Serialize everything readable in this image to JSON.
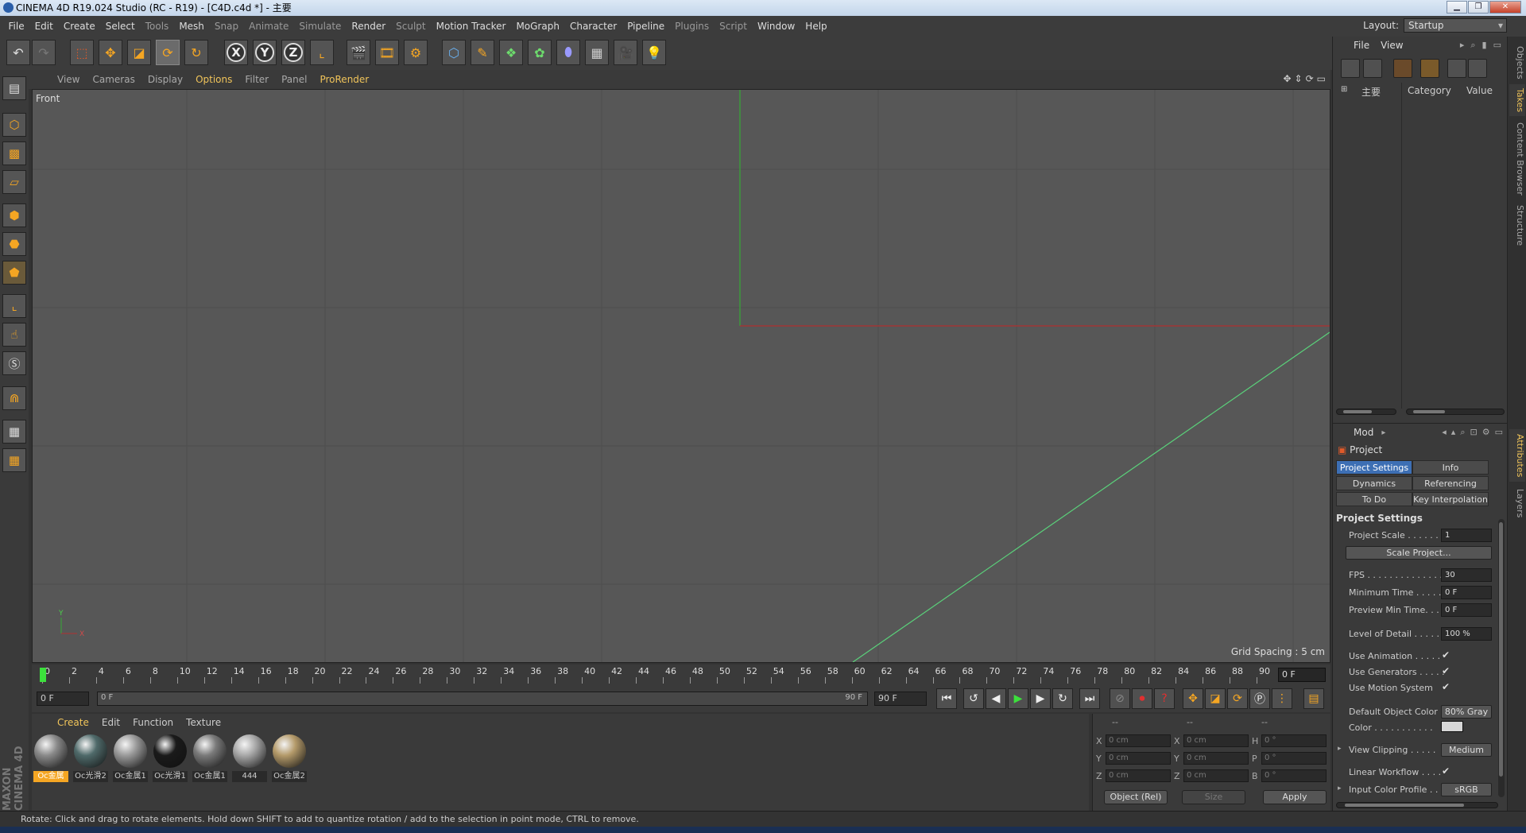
{
  "window": {
    "title": "CINEMA 4D R19.024 Studio (RC - R19) - [C4D.c4d *] - 主要",
    "btn_min": "▁",
    "btn_max": "❐",
    "btn_close": "✕"
  },
  "menu": [
    "File",
    "Edit",
    "Create",
    "Select",
    "Tools",
    "Mesh",
    "Snap",
    "Animate",
    "Simulate",
    "Render",
    "Sculpt",
    "Motion Tracker",
    "MoGraph",
    "Character",
    "Pipeline",
    "Plugins",
    "Script",
    "Window",
    "Help"
  ],
  "layout": {
    "label": "Layout:",
    "value": "Startup"
  },
  "toolbar": {
    "axis_x": "X",
    "axis_y": "Y",
    "axis_z": "Z"
  },
  "viewport_menu": [
    "View",
    "Cameras",
    "Display",
    "Options",
    "Filter",
    "Panel",
    "ProRender"
  ],
  "viewport": {
    "label": "Front",
    "grid_spacing": "Grid Spacing : 5 cm",
    "axis_y": "Y",
    "axis_x": "X"
  },
  "timeline": {
    "ticks": [
      "0",
      "2",
      "4",
      "6",
      "8",
      "10",
      "12",
      "14",
      "16",
      "18",
      "20",
      "22",
      "24",
      "26",
      "28",
      "30",
      "32",
      "34",
      "36",
      "38",
      "40",
      "42",
      "44",
      "46",
      "48",
      "50",
      "52",
      "54",
      "56",
      "58",
      "60",
      "62",
      "64",
      "66",
      "68",
      "70",
      "72",
      "74",
      "76",
      "78",
      "80",
      "82",
      "84",
      "86",
      "88",
      "90"
    ],
    "current_frame": "0 F"
  },
  "transport": {
    "start": "0 F",
    "slider_left": "0 F",
    "slider_right": "90 F",
    "end": "90 F"
  },
  "materials_menu": [
    "Create",
    "Edit",
    "Function",
    "Texture"
  ],
  "materials": [
    {
      "name": "Oc金属",
      "color": "#8a8a8a"
    },
    {
      "name": "Oc光滑2",
      "color": "#4f6a6a"
    },
    {
      "name": "Oc金属1",
      "color": "#9a9a9a"
    },
    {
      "name": "Oc光滑1",
      "color": "#1a1a1a"
    },
    {
      "name": "Oc金属1",
      "color": "#7a7a7a"
    },
    {
      "name": "444",
      "color": "#a8a8a8"
    },
    {
      "name": "Oc金属2",
      "color": "#b49a6a"
    }
  ],
  "coords": {
    "dashes": [
      "--",
      "--",
      "--"
    ],
    "labels": [
      "X",
      "Y",
      "Z",
      "X",
      "Y",
      "Z",
      "H",
      "P",
      "B"
    ],
    "pos": [
      "0 cm",
      "0 cm",
      "0 cm"
    ],
    "size": [
      "0 cm",
      "0 cm",
      "0 cm"
    ],
    "rot": [
      "0 °",
      "0 °",
      "0 °"
    ],
    "mode": "Object (Rel)",
    "size_mode": "Size",
    "apply": "Apply"
  },
  "objects_panel": {
    "menu": [
      "File",
      "View"
    ],
    "take_main": "主要",
    "col_category": "Category",
    "col_value": "Value"
  },
  "side_tabs": [
    "Objects",
    "Takes",
    "Content Browser",
    "Structure",
    "Attributes",
    "Layers"
  ],
  "attributes": {
    "menu": "Mod",
    "object": "Project",
    "tabs": [
      "Project Settings",
      "Info",
      "Dynamics",
      "Referencing",
      "To Do",
      "Key Interpolation"
    ],
    "section": "Project Settings",
    "project_scale_label": "Project Scale . . . . . .",
    "project_scale_value": "1",
    "scale_project_btn": "Scale Project...",
    "fps_label": "FPS . . . . . . . . . . . . . .",
    "fps_value": "30",
    "min_time_label": "Minimum Time . . . . .",
    "min_time_value": "0 F",
    "preview_min_label": "Preview Min Time. . .",
    "preview_min_value": "0 F",
    "lod_label": "Level of Detail . . . . .",
    "lod_value": "100 %",
    "use_anim_label": "Use Animation . . . . .",
    "use_gen_label": "Use Generators . . . . .",
    "use_motion_label": "Use Motion System",
    "def_color_label": "Default Object Color",
    "def_color_value": "80% Gray",
    "color_label": "Color . . . . . . . . . . .",
    "view_clip_label": "View Clipping . . . . .",
    "view_clip_value": "Medium",
    "linear_label": "Linear Workflow . . . .",
    "input_profile_label": "Input Color Profile . . .",
    "input_profile_value": "sRGB",
    "check": "✔"
  },
  "status": "Rotate: Click and drag to rotate elements. Hold down SHIFT to add to quantize rotation / add to the selection in point mode, CTRL to remove."
}
